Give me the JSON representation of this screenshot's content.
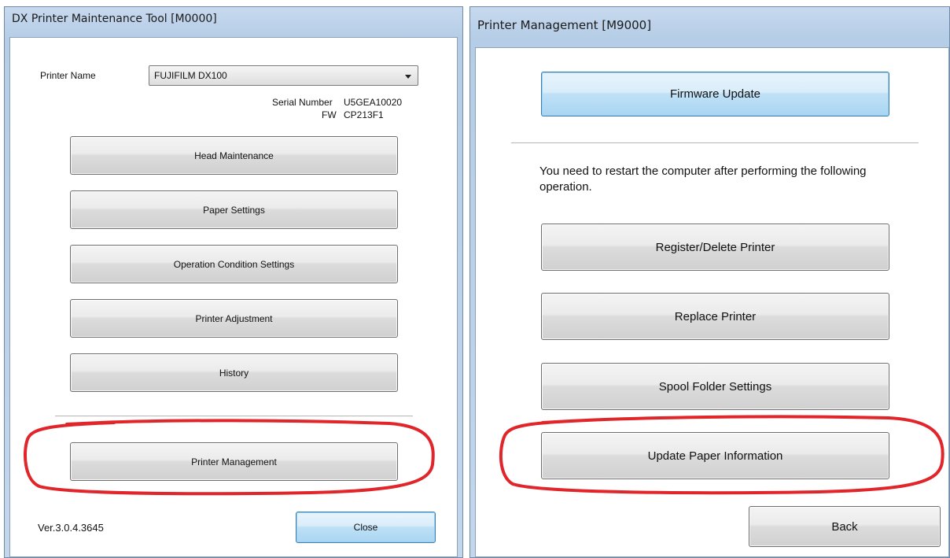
{
  "left_window": {
    "title": "DX Printer Maintenance Tool [M0000]",
    "printer_name_label": "Printer Name",
    "printer_name_value": "FUJIFILM DX100",
    "serial_label": "Serial Number",
    "serial_value": "U5GEA10020",
    "fw_label": "FW",
    "fw_value": "CP213F1",
    "buttons": {
      "head_maintenance": "Head Maintenance",
      "paper_settings": "Paper Settings",
      "operation_condition_settings": "Operation Condition Settings",
      "printer_adjustment": "Printer Adjustment",
      "history": "History",
      "printer_management": "Printer Management",
      "close": "Close"
    },
    "version": "Ver.3.0.4.3645"
  },
  "right_window": {
    "title": "Printer Management [M9000]",
    "buttons": {
      "firmware_update": "Firmware Update",
      "register_delete_printer": "Register/Delete Printer",
      "replace_printer": "Replace Printer",
      "spool_folder_settings": "Spool Folder Settings",
      "update_paper_information": "Update Paper Information",
      "back": "Back"
    },
    "restart_notice": "You need to restart the computer after performing the following operation."
  },
  "colors": {
    "annotation_red": "#e0262a",
    "focus_button_blue": "#3c7fb1"
  }
}
